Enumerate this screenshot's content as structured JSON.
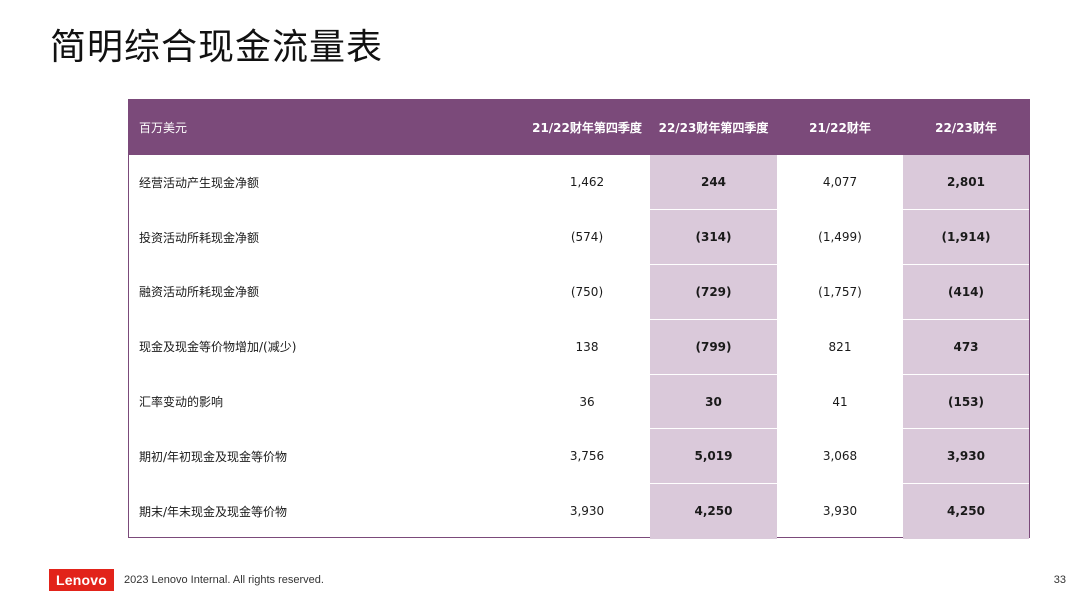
{
  "title": "简明综合现金流量表",
  "table": {
    "headers": [
      "百万美元",
      "21/22财年第四季度",
      "22/23财年第四季度",
      "21/22财年",
      "22/23财年"
    ],
    "rows": [
      {
        "label": "经营活动产生现金净额",
        "values": [
          "1,462",
          "244",
          "4,077",
          "2,801"
        ]
      },
      {
        "label": "投资活动所耗现金净额",
        "values": [
          "(574)",
          "(314)",
          "(1,499)",
          "(1,914)"
        ]
      },
      {
        "label": "融资活动所耗现金净额",
        "values": [
          "(750)",
          "(729)",
          "(1,757)",
          "(414)"
        ]
      },
      {
        "label": "现金及现金等价物增加/(减少)",
        "values": [
          "138",
          "(799)",
          "821",
          "473"
        ]
      },
      {
        "label": "汇率变动的影响",
        "values": [
          "36",
          "30",
          "41",
          "(153)"
        ]
      },
      {
        "label": "期初/年初现金及现金等价物",
        "values": [
          "3,756",
          "5,019",
          "3,068",
          "3,930"
        ]
      },
      {
        "label": "期末/年末现金及现金等价物",
        "values": [
          "3,930",
          "4,250",
          "3,930",
          "4,250"
        ]
      }
    ]
  },
  "footer": {
    "logo": "Lenovo",
    "copyright": "2023 Lenovo Internal. All rights reserved.",
    "page_number": "33"
  },
  "colors": {
    "header_bg": "#7b4a7a",
    "highlight_bg": "#dac9da",
    "logo_bg": "#e2231a"
  }
}
